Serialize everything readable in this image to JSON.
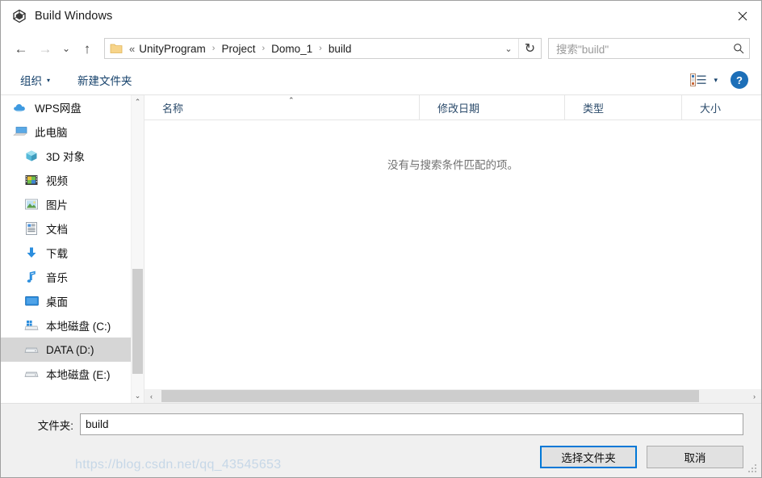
{
  "window": {
    "title": "Build Windows",
    "app_icon": "unity-logo-icon",
    "close_label": "✕"
  },
  "nav": {
    "back": "←",
    "forward": "→",
    "recent": "⌄",
    "up": "↑",
    "refresh": "↻",
    "dropdown": "⌄",
    "breadcrumb_ellipsis": "«",
    "separator": "›",
    "crumbs": [
      "UnityProgram",
      "Project",
      "Domo_1",
      "build"
    ]
  },
  "search": {
    "placeholder": "搜索\"build\"",
    "icon": "search-icon"
  },
  "toolbar": {
    "organize": "组织",
    "organize_caret": "▾",
    "new_folder": "新建文件夹",
    "view_caret": "▾",
    "help": "?"
  },
  "sidebar": {
    "items": [
      {
        "label": "WPS网盘",
        "icon": "cloud-icon",
        "indent": false,
        "selected": false
      },
      {
        "label": "此电脑",
        "icon": "this-pc-icon",
        "indent": false,
        "selected": false
      },
      {
        "label": "3D 对象",
        "icon": "3d-objects-icon",
        "indent": true,
        "selected": false
      },
      {
        "label": "视频",
        "icon": "videos-icon",
        "indent": true,
        "selected": false
      },
      {
        "label": "图片",
        "icon": "pictures-icon",
        "indent": true,
        "selected": false
      },
      {
        "label": "文档",
        "icon": "documents-icon",
        "indent": true,
        "selected": false
      },
      {
        "label": "下载",
        "icon": "downloads-icon",
        "indent": true,
        "selected": false
      },
      {
        "label": "音乐",
        "icon": "music-icon",
        "indent": true,
        "selected": false
      },
      {
        "label": "桌面",
        "icon": "desktop-icon",
        "indent": true,
        "selected": false
      },
      {
        "label": "本地磁盘 (C:)",
        "icon": "windows-drive-icon",
        "indent": true,
        "selected": false
      },
      {
        "label": "DATA (D:)",
        "icon": "drive-icon",
        "indent": true,
        "selected": true
      },
      {
        "label": "本地磁盘 (E:)",
        "icon": "drive-icon",
        "indent": true,
        "selected": false
      }
    ],
    "scroll_up": "⌃",
    "scroll_down": "⌄"
  },
  "filelist": {
    "columns": [
      "名称",
      "修改日期",
      "类型",
      "大小"
    ],
    "sort_indicator": "⌃",
    "empty_message": "没有与搜索条件匹配的项。",
    "rows": [],
    "scroll_left": "‹",
    "scroll_right": "›"
  },
  "footer": {
    "folder_label": "文件夹:",
    "folder_value": "build",
    "select_button": "选择文件夹",
    "cancel_button": "取消",
    "watermark": "https://blog.csdn.net/qq_43545653"
  },
  "colors": {
    "accent": "#0078d7",
    "toolbar_text": "#15416b",
    "selection": "#d6d6d6",
    "help_blue": "#1d6fb8"
  }
}
